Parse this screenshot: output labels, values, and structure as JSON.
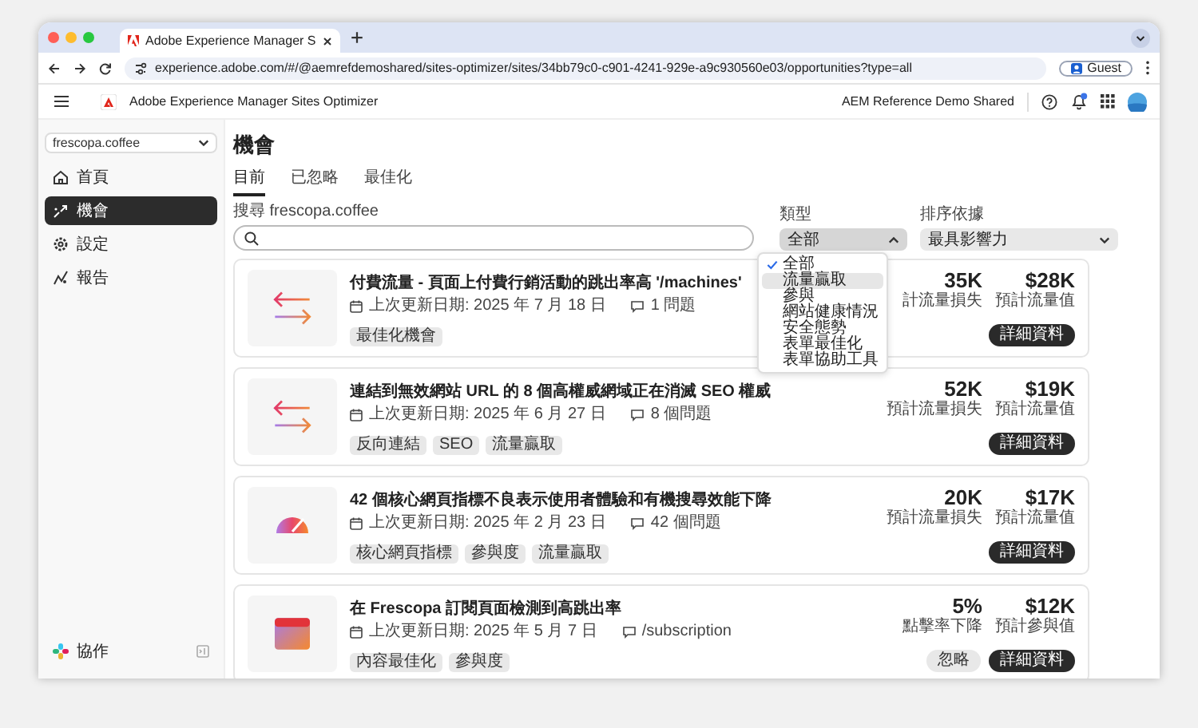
{
  "browser": {
    "tab_title": "Adobe Experience Manager S",
    "url": "experience.adobe.com/#/@aemrefdemoshared/sites-optimizer/sites/34bb79c0-c901-4241-929e-a9c930560e03/opportunities?type=all",
    "profile": "Guest"
  },
  "app": {
    "title": "Adobe Experience Manager Sites Optimizer",
    "org": "AEM Reference Demo Shared"
  },
  "sidebar": {
    "site": "frescopa.coffee",
    "items": [
      {
        "label": "首頁",
        "kind": "home",
        "selected": false
      },
      {
        "label": "機會",
        "kind": "opportunities",
        "selected": true
      },
      {
        "label": "設定",
        "kind": "settings",
        "selected": false
      },
      {
        "label": "報告",
        "kind": "reports",
        "selected": false
      }
    ],
    "footer": "協作"
  },
  "page": {
    "title": "機會",
    "tabs": [
      {
        "label": "目前",
        "selected": true
      },
      {
        "label": "已忽略",
        "selected": false
      },
      {
        "label": "最佳化",
        "selected": false
      }
    ],
    "search": {
      "label": "搜尋 frescopa.coffee"
    },
    "filters": [
      {
        "label": "類型",
        "value": "全部",
        "open": true,
        "options": [
          {
            "label": "全部",
            "selected": true,
            "highlighted": false
          },
          {
            "label": "流量贏取",
            "selected": false,
            "highlighted": true
          },
          {
            "label": "參與",
            "selected": false,
            "highlighted": false
          },
          {
            "label": "網站健康情況",
            "selected": false,
            "highlighted": false
          },
          {
            "label": "安全態勢",
            "selected": false,
            "highlighted": false
          },
          {
            "label": "表單最佳化",
            "selected": false,
            "highlighted": false
          },
          {
            "label": "表單協助工具",
            "selected": false,
            "highlighted": false
          }
        ]
      },
      {
        "label": "排序依據",
        "value": "最具影響力",
        "open": false
      }
    ],
    "opportunities": [
      {
        "kind": "arrows",
        "title": "付費流量 - 頁面上付費行銷活動的跳出率高 '/machines'",
        "updated": "上次更新日期: 2025 年 7 月 18 日",
        "detail": "1 問題",
        "tags": [
          "最佳化機會"
        ],
        "metrics": [
          {
            "value": "35K",
            "label": "計流量損失"
          },
          {
            "value": "$28K",
            "label": "預計流量值"
          }
        ],
        "buttons": [
          {
            "label": "詳細資料",
            "kind": "primary"
          }
        ]
      },
      {
        "kind": "arrows",
        "title": "連結到無效網站 URL 的 8 個高權威網域正在消滅 SEO 權威",
        "updated": "上次更新日期: 2025 年 6 月 27 日",
        "detail": "8 個問題",
        "tags": [
          "反向連結",
          "SEO",
          "流量贏取"
        ],
        "metrics": [
          {
            "value": "52K",
            "label": "預計流量損失"
          },
          {
            "value": "$19K",
            "label": "預計流量值"
          }
        ],
        "buttons": [
          {
            "label": "詳細資料",
            "kind": "primary"
          }
        ]
      },
      {
        "kind": "gauge",
        "title": "42 個核心網頁指標不良表示使用者體驗和有機搜尋效能下降",
        "updated": "上次更新日期: 2025 年 2 月 23 日",
        "detail": "42 個問題",
        "tags": [
          "核心網頁指標",
          "參與度",
          "流量贏取"
        ],
        "metrics": [
          {
            "value": "20K",
            "label": "預計流量損失"
          },
          {
            "value": "$17K",
            "label": "預計流量值"
          }
        ],
        "buttons": [
          {
            "label": "詳細資料",
            "kind": "primary"
          }
        ]
      },
      {
        "kind": "window",
        "title": "在 Frescopa 訂閱頁面檢測到高跳出率",
        "updated": "上次更新日期: 2025 年 5 月 7 日",
        "detail": "/subscription",
        "tags": [
          "內容最佳化",
          "參與度"
        ],
        "metrics": [
          {
            "value": "5%",
            "label": "點擊率下降"
          },
          {
            "value": "$12K",
            "label": "預計參與值"
          }
        ],
        "buttons": [
          {
            "label": "忽略",
            "kind": "secondary"
          },
          {
            "label": "詳細資料",
            "kind": "primary"
          }
        ]
      }
    ]
  }
}
